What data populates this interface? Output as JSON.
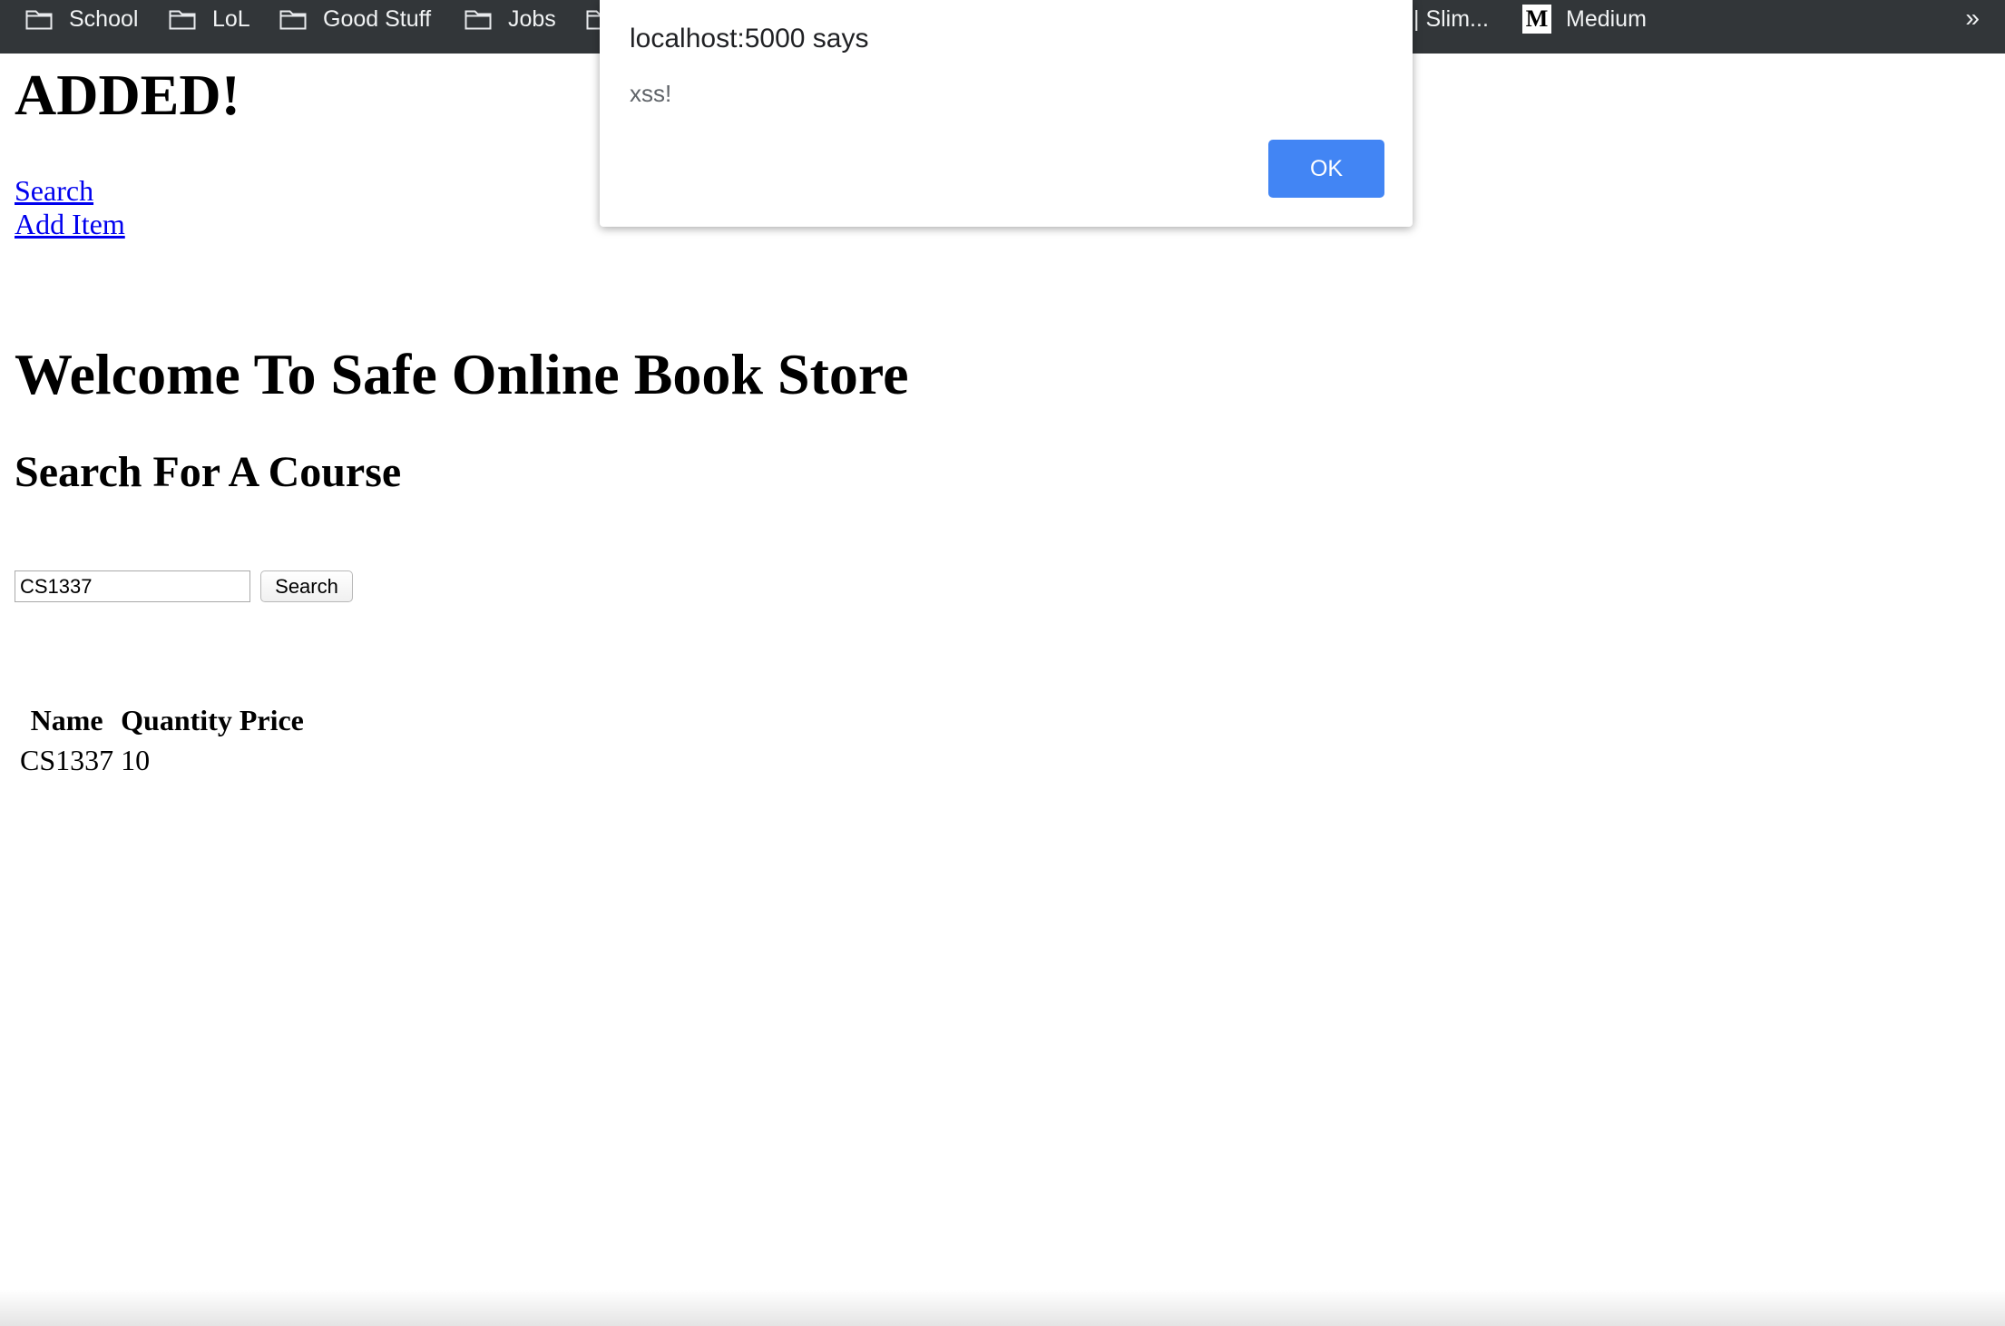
{
  "bookmarks_bar": {
    "items": [
      {
        "label": "School",
        "icon": "folder-icon"
      },
      {
        "label": "LoL",
        "icon": "folder-icon"
      },
      {
        "label": "Good Stuff",
        "icon": "folder-icon"
      },
      {
        "label": "Jobs",
        "icon": "folder-icon"
      },
      {
        "label": "",
        "icon": "folder-icon"
      },
      {
        "label": "| Slim...",
        "icon": ""
      },
      {
        "label": "Medium",
        "icon": "medium-logo-icon"
      }
    ],
    "overflow_label": "»",
    "medium_logo_letter": "M"
  },
  "page": {
    "added_heading": "ADDED!",
    "nav": {
      "search_link": "Search",
      "add_item_link": "Add Item"
    },
    "welcome_heading": "Welcome To Safe Online Book Store",
    "search_heading": "Search For A Course",
    "search_form": {
      "input_value": "CS1337",
      "button_label": "Search"
    },
    "results_table": {
      "columns": [
        "Name",
        "Quantity",
        "Price"
      ],
      "rows": [
        [
          "CS1337",
          "10",
          ""
        ]
      ]
    }
  },
  "alert": {
    "title": "localhost:5000 says",
    "message": "xss!",
    "ok_label": "OK",
    "ok_color": "#4285f4"
  },
  "colors": {
    "bookmarks_bar_bg": "#323639",
    "link": "#0000ee"
  }
}
